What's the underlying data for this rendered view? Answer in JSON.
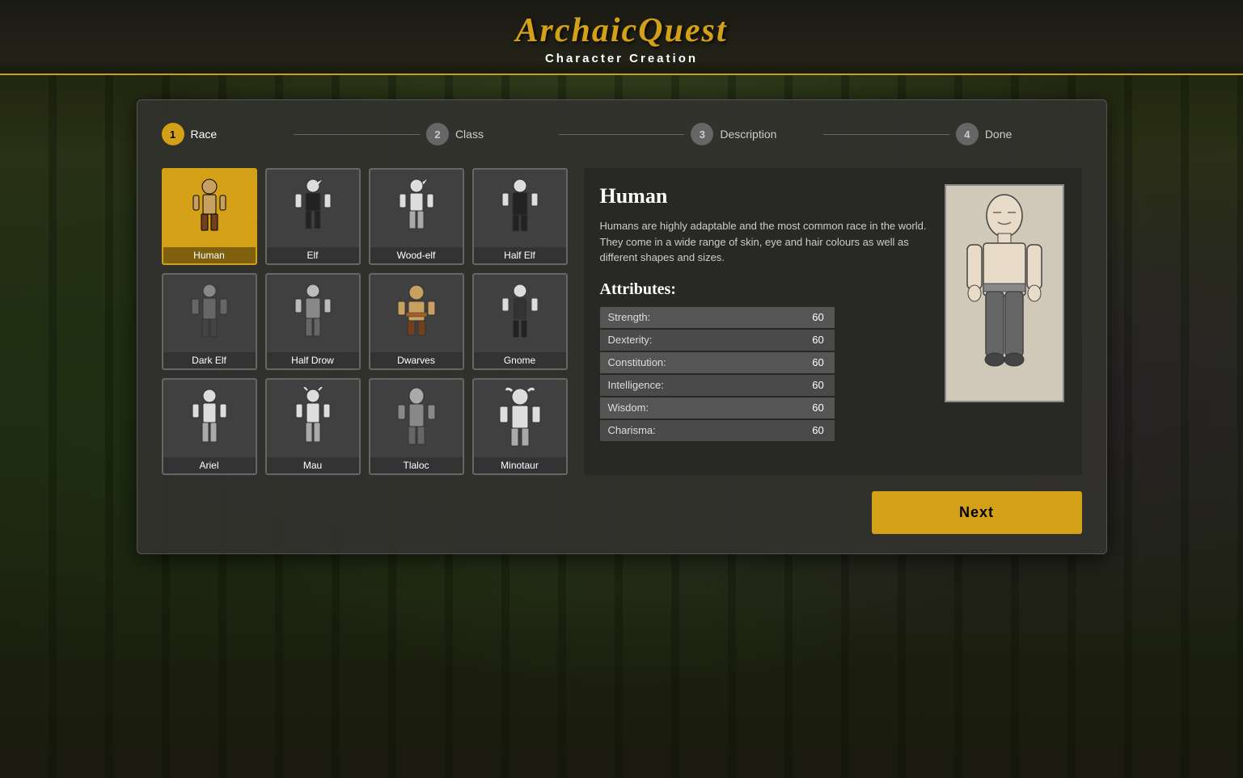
{
  "app": {
    "title": "ArchaicQuest",
    "subtitle": "Character Creation"
  },
  "steps": [
    {
      "number": "1",
      "label": "Race",
      "active": true
    },
    {
      "number": "2",
      "label": "Class",
      "active": false
    },
    {
      "number": "3",
      "label": "Description",
      "active": false
    },
    {
      "number": "4",
      "label": "Done",
      "active": false
    }
  ],
  "races": [
    {
      "id": "human",
      "label": "Human",
      "selected": true
    },
    {
      "id": "elf",
      "label": "Elf",
      "selected": false
    },
    {
      "id": "wood-elf",
      "label": "Wood-elf",
      "selected": false
    },
    {
      "id": "half-elf",
      "label": "Half Elf",
      "selected": false
    },
    {
      "id": "dark-elf",
      "label": "Dark Elf",
      "selected": false
    },
    {
      "id": "half-drow",
      "label": "Half Drow",
      "selected": false
    },
    {
      "id": "dwarves",
      "label": "Dwarves",
      "selected": false
    },
    {
      "id": "gnome",
      "label": "Gnome",
      "selected": false
    },
    {
      "id": "ariel",
      "label": "Ariel",
      "selected": false
    },
    {
      "id": "mau",
      "label": "Mau",
      "selected": false
    },
    {
      "id": "tlaloc",
      "label": "Tlaloc",
      "selected": false
    },
    {
      "id": "minotaur",
      "label": "Minotaur",
      "selected": false
    }
  ],
  "selected_race": {
    "name": "Human",
    "description": "Humans are highly adaptable and the most common race in the world. They come in a wide range of skin, eye and hair colours as well as different shapes and sizes.",
    "attributes_title": "Attributes:",
    "attributes": [
      {
        "name": "Strength:",
        "value": "60",
        "alt": false
      },
      {
        "name": "Dexterity:",
        "value": "60",
        "alt": true
      },
      {
        "name": "Constitution:",
        "value": "60",
        "alt": false
      },
      {
        "name": "Intelligence:",
        "value": "60",
        "alt": true
      },
      {
        "name": "Wisdom:",
        "value": "60",
        "alt": false
      },
      {
        "name": "Charisma:",
        "value": "60",
        "alt": true
      }
    ]
  },
  "buttons": {
    "next": "Next"
  }
}
